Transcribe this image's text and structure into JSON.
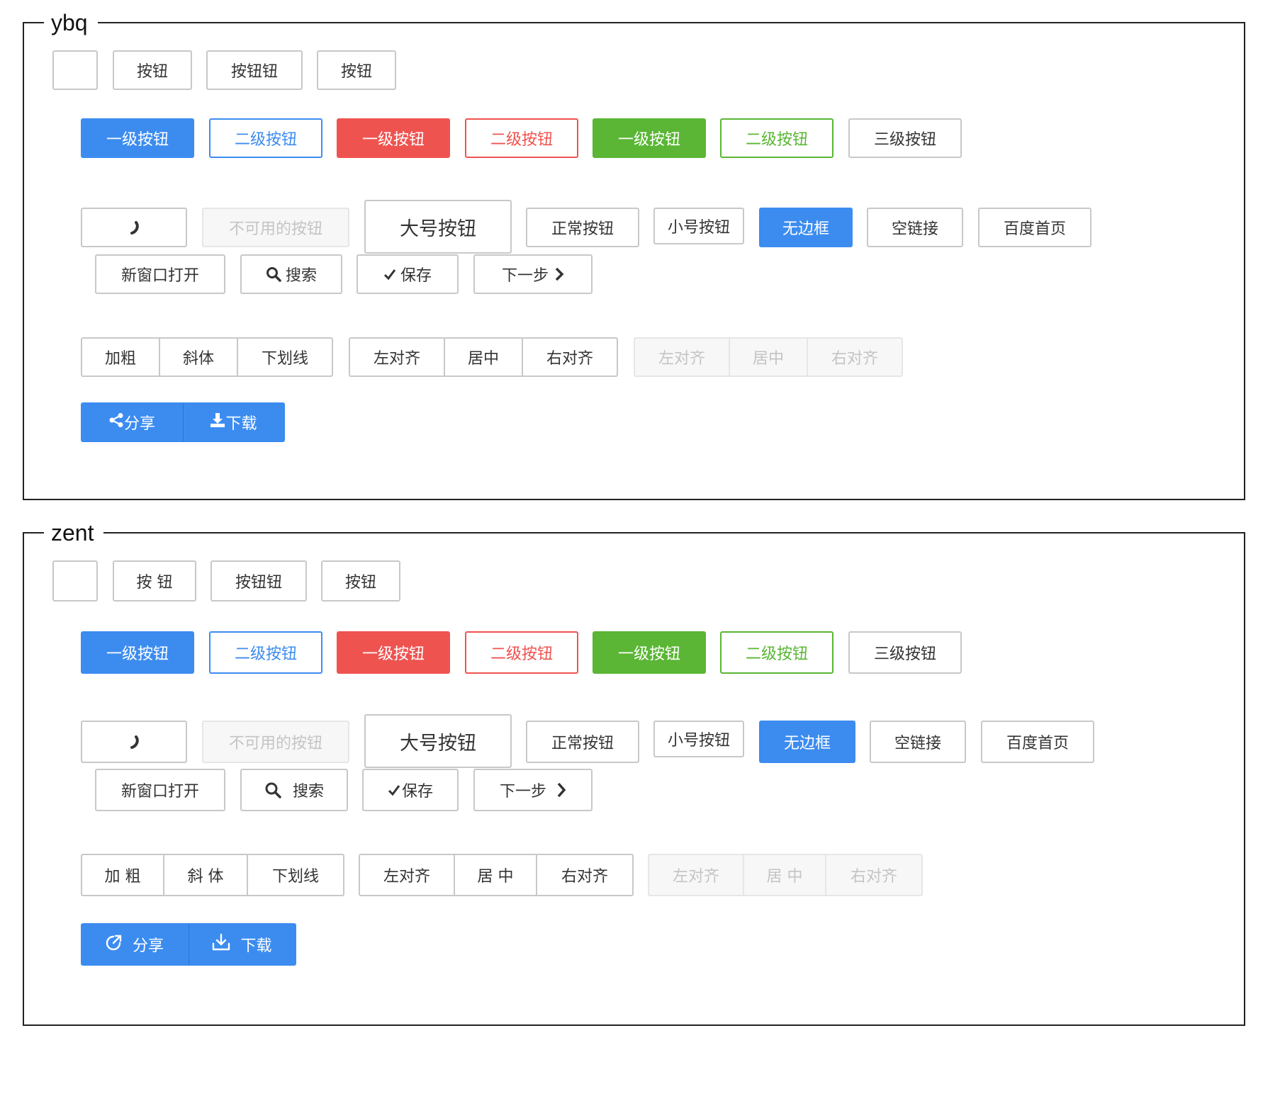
{
  "colors": {
    "primary": "#3c8cf0",
    "danger": "#ef5350",
    "success": "#5ab634",
    "border": "#c8c8c8",
    "disabled_text": "#c4c4c4"
  },
  "sections": [
    {
      "title": "ybq",
      "row1": [
        "",
        "按钮",
        "按钮钮",
        "按钮"
      ],
      "levels": [
        "一级按钮",
        "二级按钮",
        "一级按钮",
        "二级按钮",
        "一级按钮",
        "二级按钮",
        "三级按钮"
      ],
      "loading_icon": "spinner-icon",
      "disabled_label": "不可用的按钮",
      "large_label": "大号按钮",
      "normal_label": "正常按钮",
      "small_label": "小号按钮",
      "borderless_label": "无边框",
      "empty_link_label": "空链接",
      "baidu_label": "百度首页",
      "new_window_label": "新窗口打开",
      "search_label": "搜索",
      "save_label": "保存",
      "next_label": "下一步",
      "text_style_group": [
        "加粗",
        "斜体",
        "下划线"
      ],
      "align_group": [
        "左对齐",
        "居中",
        "右对齐"
      ],
      "align_group_disabled": [
        "左对齐",
        "居中",
        "右对齐"
      ],
      "share_label": "分享",
      "download_label": "下载",
      "icons": {
        "search": "search-icon",
        "save": "check-icon",
        "next": "chevron-right-icon",
        "share": "share-icon",
        "download": "download-icon"
      }
    },
    {
      "title": "zent",
      "row1": [
        "",
        "按 钮",
        "按钮钮",
        "按钮"
      ],
      "levels": [
        "一级按钮",
        "二级按钮",
        "一级按钮",
        "二级按钮",
        "一级按钮",
        "二级按钮",
        "三级按钮"
      ],
      "loading_icon": "spinner-icon",
      "disabled_label": "不可用的按钮",
      "large_label": "大号按钮",
      "normal_label": "正常按钮",
      "small_label": "小号按钮",
      "borderless_label": "无边框",
      "empty_link_label": "空链接",
      "baidu_label": "百度首页",
      "new_window_label": "新窗口打开",
      "search_label": "搜索",
      "save_label": "保存",
      "next_label": "下一步",
      "text_style_group": [
        "加 粗",
        "斜 体",
        "下划线"
      ],
      "align_group": [
        "左对齐",
        "居 中",
        "右对齐"
      ],
      "align_group_disabled": [
        "左对齐",
        "居 中",
        "右对齐"
      ],
      "share_label": "分享",
      "download_label": "下载",
      "icons": {
        "search": "search-icon",
        "save": "check-icon",
        "next": "chevron-right-icon",
        "share": "external-share-icon",
        "download": "download-tray-icon"
      }
    }
  ]
}
